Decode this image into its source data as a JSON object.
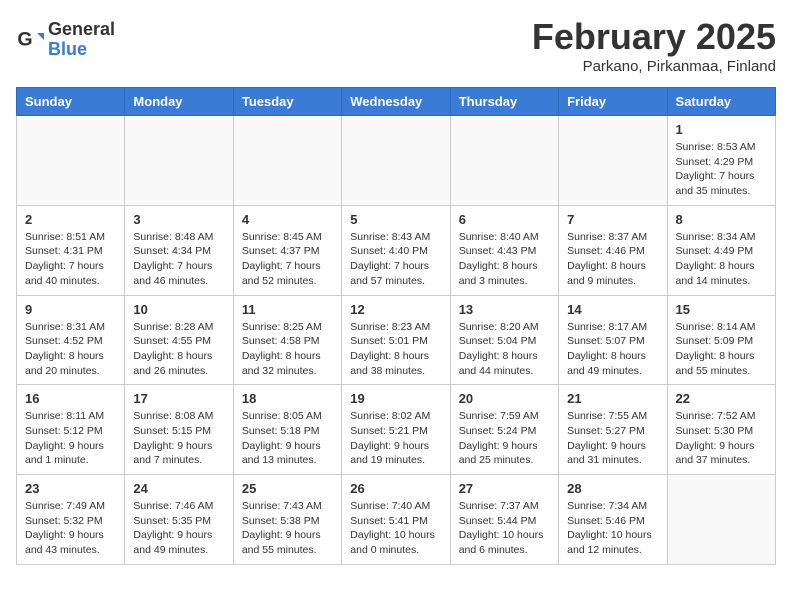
{
  "header": {
    "logo_general": "General",
    "logo_blue": "Blue",
    "title": "February 2025",
    "subtitle": "Parkano, Pirkanmaa, Finland"
  },
  "weekdays": [
    "Sunday",
    "Monday",
    "Tuesday",
    "Wednesday",
    "Thursday",
    "Friday",
    "Saturday"
  ],
  "weeks": [
    [
      {
        "day": "",
        "info": ""
      },
      {
        "day": "",
        "info": ""
      },
      {
        "day": "",
        "info": ""
      },
      {
        "day": "",
        "info": ""
      },
      {
        "day": "",
        "info": ""
      },
      {
        "day": "",
        "info": ""
      },
      {
        "day": "1",
        "info": "Sunrise: 8:53 AM\nSunset: 4:29 PM\nDaylight: 7 hours and 35 minutes."
      }
    ],
    [
      {
        "day": "2",
        "info": "Sunrise: 8:51 AM\nSunset: 4:31 PM\nDaylight: 7 hours and 40 minutes."
      },
      {
        "day": "3",
        "info": "Sunrise: 8:48 AM\nSunset: 4:34 PM\nDaylight: 7 hours and 46 minutes."
      },
      {
        "day": "4",
        "info": "Sunrise: 8:45 AM\nSunset: 4:37 PM\nDaylight: 7 hours and 52 minutes."
      },
      {
        "day": "5",
        "info": "Sunrise: 8:43 AM\nSunset: 4:40 PM\nDaylight: 7 hours and 57 minutes."
      },
      {
        "day": "6",
        "info": "Sunrise: 8:40 AM\nSunset: 4:43 PM\nDaylight: 8 hours and 3 minutes."
      },
      {
        "day": "7",
        "info": "Sunrise: 8:37 AM\nSunset: 4:46 PM\nDaylight: 8 hours and 9 minutes."
      },
      {
        "day": "8",
        "info": "Sunrise: 8:34 AM\nSunset: 4:49 PM\nDaylight: 8 hours and 14 minutes."
      }
    ],
    [
      {
        "day": "9",
        "info": "Sunrise: 8:31 AM\nSunset: 4:52 PM\nDaylight: 8 hours and 20 minutes."
      },
      {
        "day": "10",
        "info": "Sunrise: 8:28 AM\nSunset: 4:55 PM\nDaylight: 8 hours and 26 minutes."
      },
      {
        "day": "11",
        "info": "Sunrise: 8:25 AM\nSunset: 4:58 PM\nDaylight: 8 hours and 32 minutes."
      },
      {
        "day": "12",
        "info": "Sunrise: 8:23 AM\nSunset: 5:01 PM\nDaylight: 8 hours and 38 minutes."
      },
      {
        "day": "13",
        "info": "Sunrise: 8:20 AM\nSunset: 5:04 PM\nDaylight: 8 hours and 44 minutes."
      },
      {
        "day": "14",
        "info": "Sunrise: 8:17 AM\nSunset: 5:07 PM\nDaylight: 8 hours and 49 minutes."
      },
      {
        "day": "15",
        "info": "Sunrise: 8:14 AM\nSunset: 5:09 PM\nDaylight: 8 hours and 55 minutes."
      }
    ],
    [
      {
        "day": "16",
        "info": "Sunrise: 8:11 AM\nSunset: 5:12 PM\nDaylight: 9 hours and 1 minute."
      },
      {
        "day": "17",
        "info": "Sunrise: 8:08 AM\nSunset: 5:15 PM\nDaylight: 9 hours and 7 minutes."
      },
      {
        "day": "18",
        "info": "Sunrise: 8:05 AM\nSunset: 5:18 PM\nDaylight: 9 hours and 13 minutes."
      },
      {
        "day": "19",
        "info": "Sunrise: 8:02 AM\nSunset: 5:21 PM\nDaylight: 9 hours and 19 minutes."
      },
      {
        "day": "20",
        "info": "Sunrise: 7:59 AM\nSunset: 5:24 PM\nDaylight: 9 hours and 25 minutes."
      },
      {
        "day": "21",
        "info": "Sunrise: 7:55 AM\nSunset: 5:27 PM\nDaylight: 9 hours and 31 minutes."
      },
      {
        "day": "22",
        "info": "Sunrise: 7:52 AM\nSunset: 5:30 PM\nDaylight: 9 hours and 37 minutes."
      }
    ],
    [
      {
        "day": "23",
        "info": "Sunrise: 7:49 AM\nSunset: 5:32 PM\nDaylight: 9 hours and 43 minutes."
      },
      {
        "day": "24",
        "info": "Sunrise: 7:46 AM\nSunset: 5:35 PM\nDaylight: 9 hours and 49 minutes."
      },
      {
        "day": "25",
        "info": "Sunrise: 7:43 AM\nSunset: 5:38 PM\nDaylight: 9 hours and 55 minutes."
      },
      {
        "day": "26",
        "info": "Sunrise: 7:40 AM\nSunset: 5:41 PM\nDaylight: 10 hours and 0 minutes."
      },
      {
        "day": "27",
        "info": "Sunrise: 7:37 AM\nSunset: 5:44 PM\nDaylight: 10 hours and 6 minutes."
      },
      {
        "day": "28",
        "info": "Sunrise: 7:34 AM\nSunset: 5:46 PM\nDaylight: 10 hours and 12 minutes."
      },
      {
        "day": "",
        "info": ""
      }
    ]
  ]
}
